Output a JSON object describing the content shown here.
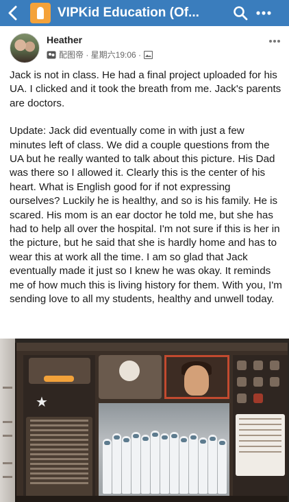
{
  "topbar": {
    "back_icon": "chevron-left-icon",
    "group_title": "VIPKid Education (Of...",
    "search_icon": "search-icon",
    "more_icon": "more-dots-icon",
    "color": "#3a7dbd"
  },
  "post": {
    "author": "Heather",
    "meta_text": "配图帝 · 星期六19:06 ·",
    "body": [
      "Jack is not in class. He had a final project uploaded for his UA. I clicked and it took the breath from me. Jack's parents are doctors.",
      "Update: Jack did eventually come in with just a few minutes left of class. We did a couple questions from the UA but he really wanted to talk about this picture. His Dad was there so I allowed it. Clearly this is the center of his heart. What is English good for if not expressing ourselves? Luckily he is healthy, and so is his family. He is scared. His mom is an ear doctor he told me, but she has had to help all over the hospital. I'm not sure if this is her in the picture, but he said that she is hardly home and has to wear this at work all the time. I am so glad that Jack eventually made it just so I knew he was okay. It reminds me of how much this is living history for them. With you, I'm sending love to all my students, healthy and unwell today."
    ]
  }
}
